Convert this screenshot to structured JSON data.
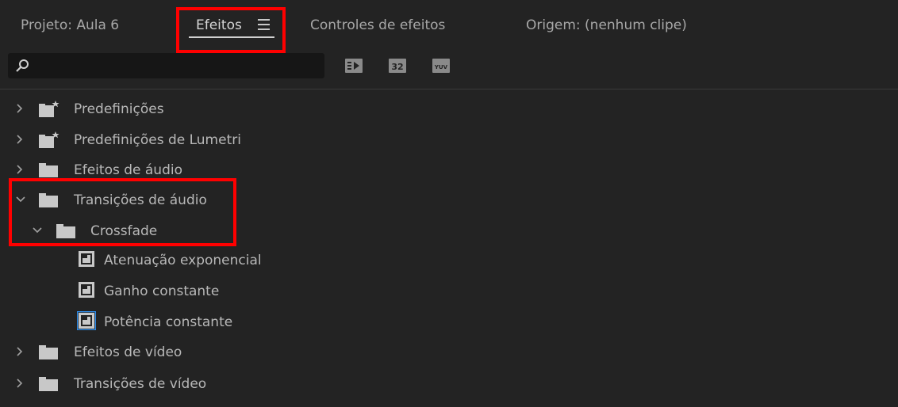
{
  "tabs": [
    {
      "label": "Projeto: Aula 6",
      "active": false
    },
    {
      "label": "Efeitos",
      "active": true
    },
    {
      "label": "Controles de efeitos",
      "active": false
    },
    {
      "label": "Origem: (nenhum clipe)",
      "active": false
    }
  ],
  "search": {
    "value": "",
    "placeholder": ""
  },
  "toolbar": {
    "accelerated_label": "",
    "bit32_label": "32",
    "yuv_label": "YUV"
  },
  "tree": {
    "predefinicoes": {
      "label": "Predefinições",
      "expanded": false
    },
    "lumetri": {
      "label": "Predefinições de Lumetri",
      "expanded": false
    },
    "efeitos_audio": {
      "label": "Efeitos de áudio",
      "expanded": false
    },
    "transicoes_audio": {
      "label": "Transições de áudio",
      "expanded": true
    },
    "crossfade": {
      "label": "Crossfade",
      "expanded": true
    },
    "atenuacao": {
      "label": "Atenuação exponencial"
    },
    "ganho": {
      "label": "Ganho constante"
    },
    "potencia": {
      "label": "Potência constante",
      "selected": true
    },
    "efeitos_video": {
      "label": "Efeitos de vídeo",
      "expanded": false
    },
    "transicoes_video": {
      "label": "Transições de vídeo",
      "expanded": false
    }
  },
  "colors": {
    "background": "#232323",
    "highlight": "#ff0000",
    "selected_outline": "#2d8ceb"
  }
}
